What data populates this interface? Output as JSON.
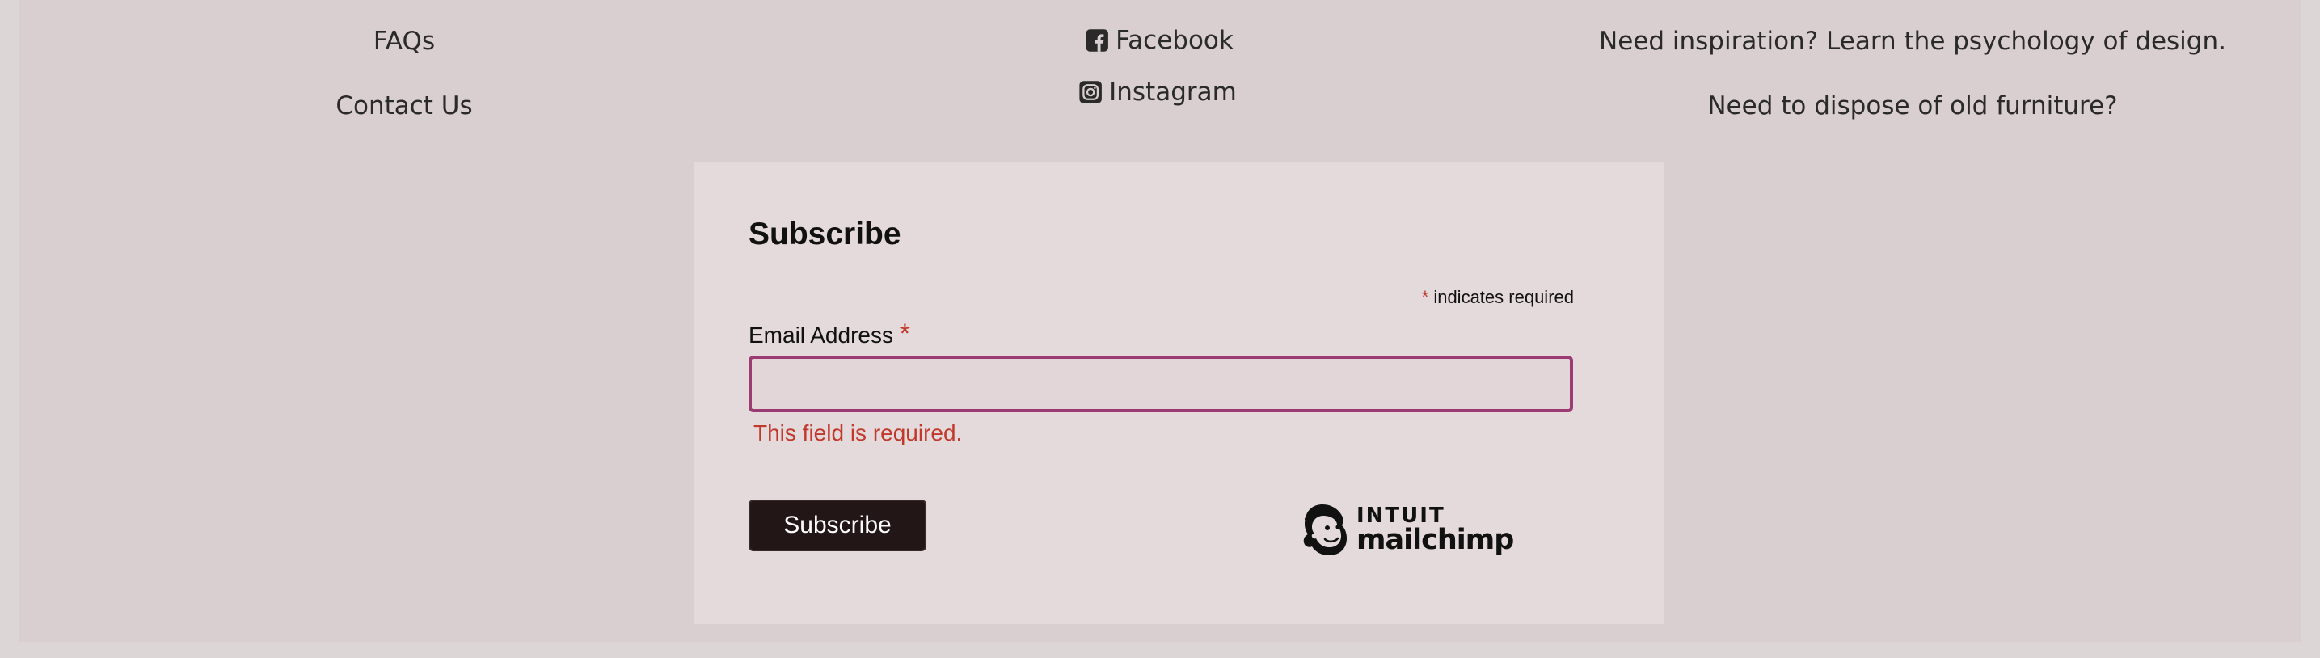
{
  "footer": {
    "col1": [
      "FAQs",
      "Contact Us"
    ],
    "social": [
      {
        "icon": "facebook-icon",
        "label": "Facebook"
      },
      {
        "icon": "instagram-icon",
        "label": "Instagram"
      }
    ],
    "col3": [
      "Need inspiration? Learn the psychology of design.",
      "Need to dispose of old furniture?"
    ]
  },
  "subscribe": {
    "title": "Subscribe",
    "required_asterisk": "*",
    "required_note": "indicates required",
    "email_label": "Email Address",
    "email_value": "",
    "error": "This field is required.",
    "button": "Subscribe"
  },
  "branding": {
    "top": "INTUIT",
    "bottom": "mailchimp",
    "icon": "mailchimp-freddie-icon"
  },
  "colors": {
    "background": "#d9cfd1",
    "panel": "#e4dadc",
    "input_border": "#9c3a72",
    "error": "#c0392b",
    "button": "#221616"
  }
}
